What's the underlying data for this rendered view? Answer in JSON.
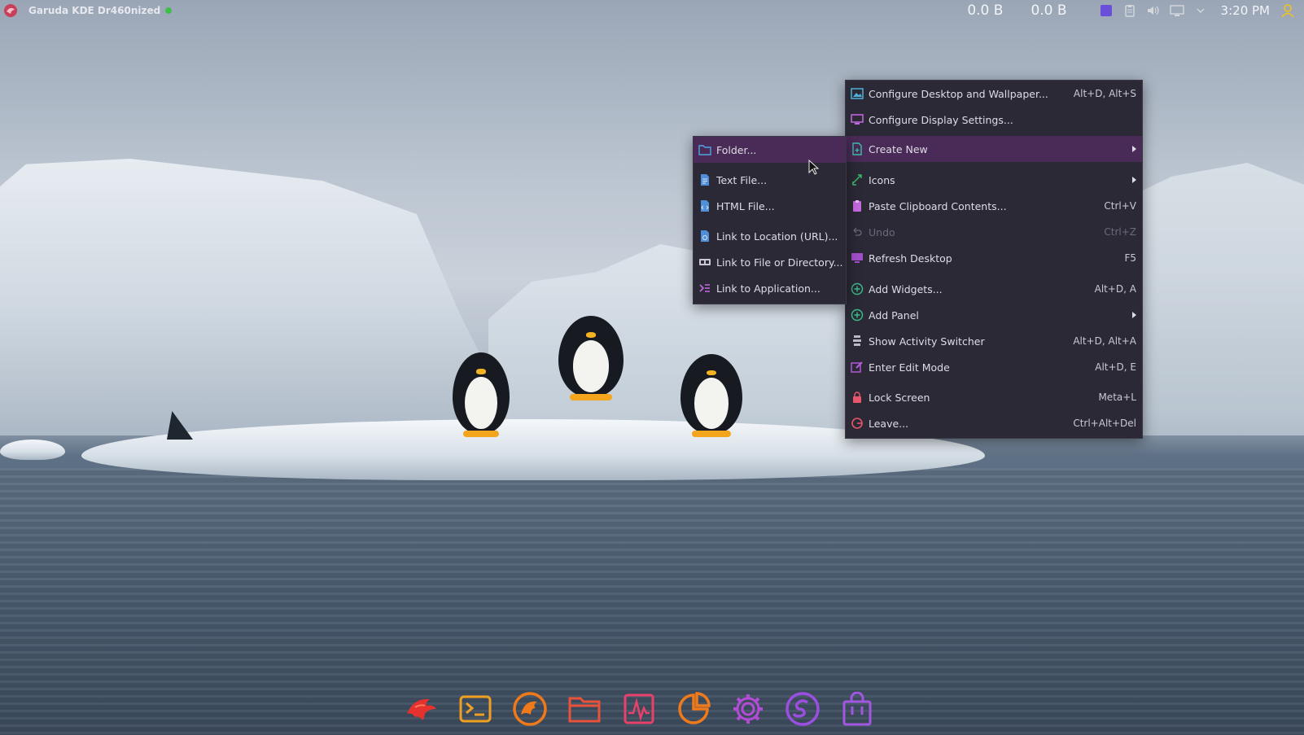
{
  "top_panel": {
    "title": "Garuda KDE Dr460nized",
    "net_down": "0.0 B",
    "net_up": "0.0 B",
    "clock": "3:20 PM"
  },
  "context_menu": {
    "items": [
      {
        "label": "Configure Desktop and Wallpaper...",
        "shortcut": "Alt+D, Alt+S",
        "icon": "wallpaper-icon"
      },
      {
        "label": "Configure Display Settings...",
        "shortcut": "",
        "icon": "display-icon"
      },
      {
        "label": "Create New",
        "shortcut": "",
        "icon": "new-file-icon",
        "submenu": true
      },
      {
        "label": "Icons",
        "shortcut": "",
        "icon": "icons-icon",
        "submenu": true
      },
      {
        "label": "Paste Clipboard Contents...",
        "shortcut": "Ctrl+V",
        "icon": "clipboard-icon"
      },
      {
        "label": "Undo",
        "shortcut": "Ctrl+Z",
        "icon": "undo-icon",
        "disabled": true
      },
      {
        "label": "Refresh Desktop",
        "shortcut": "F5",
        "icon": "refresh-icon"
      },
      {
        "label": "Add Widgets...",
        "shortcut": "Alt+D, A",
        "icon": "add-widgets-icon"
      },
      {
        "label": "Add Panel",
        "shortcut": "",
        "icon": "add-panel-icon",
        "submenu": true
      },
      {
        "label": "Show Activity Switcher",
        "shortcut": "Alt+D, Alt+A",
        "icon": "activity-icon"
      },
      {
        "label": "Enter Edit Mode",
        "shortcut": "Alt+D, E",
        "icon": "edit-icon"
      },
      {
        "label": "Lock Screen",
        "shortcut": "Meta+L",
        "icon": "lock-icon"
      },
      {
        "label": "Leave...",
        "shortcut": "Ctrl+Alt+Del",
        "icon": "leave-icon"
      }
    ]
  },
  "create_new_submenu": {
    "items": [
      {
        "label": "Folder...",
        "icon": "folder-icon"
      },
      {
        "label": "Text File...",
        "icon": "text-file-icon"
      },
      {
        "label": "HTML File...",
        "icon": "html-file-icon"
      },
      {
        "label": "Link to Location (URL)...",
        "icon": "link-url-icon"
      },
      {
        "label": "Link to File or Directory...",
        "icon": "link-file-icon"
      },
      {
        "label": "Link to Application...",
        "icon": "link-app-icon"
      }
    ]
  },
  "dock": {
    "items": [
      {
        "name": "garuda-welcome-icon"
      },
      {
        "name": "terminal-icon"
      },
      {
        "name": "firedragon-browser-icon"
      },
      {
        "name": "file-manager-icon"
      },
      {
        "name": "system-monitor-icon"
      },
      {
        "name": "disk-usage-icon"
      },
      {
        "name": "settings-icon"
      },
      {
        "name": "software-s-icon"
      },
      {
        "name": "software-store-icon"
      }
    ]
  },
  "colors": {
    "menu_bg": "#2b2936",
    "menu_highlight": "#4a2b57",
    "accent_purple": "#b34bd6",
    "accent_orange": "#f07a1a"
  }
}
